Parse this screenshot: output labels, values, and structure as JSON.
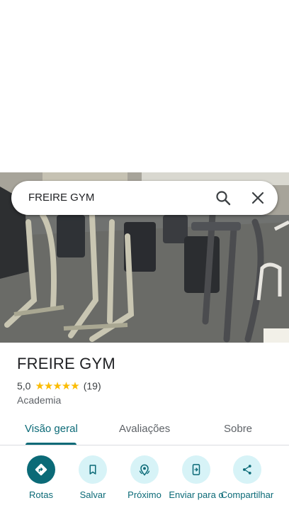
{
  "search": {
    "query": "FREIRE GYM"
  },
  "place": {
    "name": "FREIRE GYM",
    "rating": "5,0",
    "stars": "★★★★★",
    "review_count": "(19)",
    "category": "Academia"
  },
  "tabs": [
    {
      "label": "Visão geral",
      "active": true
    },
    {
      "label": "Avaliações",
      "active": false
    },
    {
      "label": "Sobre",
      "active": false
    }
  ],
  "actions": [
    {
      "label": "Rotas",
      "icon": "directions-icon"
    },
    {
      "label": "Salvar",
      "icon": "bookmark-icon"
    },
    {
      "label": "Próximo",
      "icon": "nearby-icon"
    },
    {
      "label": "Enviar para o",
      "icon": "send-to-phone-icon"
    },
    {
      "label": "Compartilhar",
      "icon": "share-icon"
    }
  ],
  "colors": {
    "accent": "#0b6a77",
    "accent_light": "#d7f3f7",
    "star": "#fbbc04"
  }
}
